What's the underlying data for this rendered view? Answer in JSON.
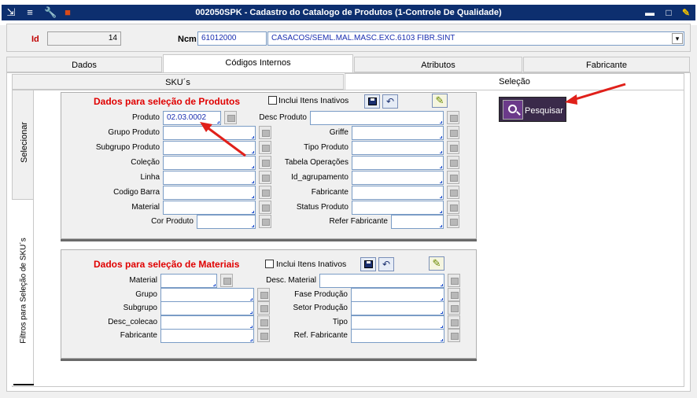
{
  "window": {
    "title": "002050SPK - Cadastro do Catalogo de Produtos (1-Controle De Qualidade)"
  },
  "header": {
    "id_label": "Id",
    "id_value": "14",
    "ncm_label": "Ncm",
    "ncm_value": "61012000",
    "ncm_desc": "CASACOS/SEML.MAL.MASC.EXC.6103 FIBR.SINT"
  },
  "main_tabs": [
    "Dados",
    "Códigos Internos",
    "Atributos",
    "Fabricante"
  ],
  "sub_tabs": [
    "SKU´s",
    "Seleção"
  ],
  "side_tabs": [
    "Selecionar",
    "Filtros para Seleção de SKU´s"
  ],
  "produtos": {
    "title": "Dados para seleção de Produtos",
    "inclui_label": "Inclui Itens Inativos",
    "left_fields": [
      "Produto",
      "Grupo Produto",
      "Subgrupo Produto",
      "Coleção",
      "Linha",
      "Codigo Barra",
      "Material",
      "Cor Produto"
    ],
    "produto_value": "02.03.0002",
    "right_fields": [
      "Desc Produto",
      "Griffe",
      "Tipo Produto",
      "Tabela Operações",
      "Id_agrupamento",
      "Fabricante",
      "Status Produto",
      "Refer Fabricante"
    ]
  },
  "pesquisar_label": "Pesquisar",
  "materiais": {
    "title": "Dados para seleção de Materiais",
    "inclui_label": "Inclui Itens Inativos",
    "left_fields": [
      "Material",
      "Grupo",
      "Subgrupo",
      "Desc_colecao",
      "Fabricante"
    ],
    "right_fields": [
      "Desc. Material",
      "Fase Produção",
      "Setor Produção",
      "Tipo",
      "Ref. Fabricante"
    ]
  },
  "colors": {
    "titlebar": "#0d2f6f",
    "section_title": "#e00000",
    "annotation_arrow": "#e0201a"
  }
}
